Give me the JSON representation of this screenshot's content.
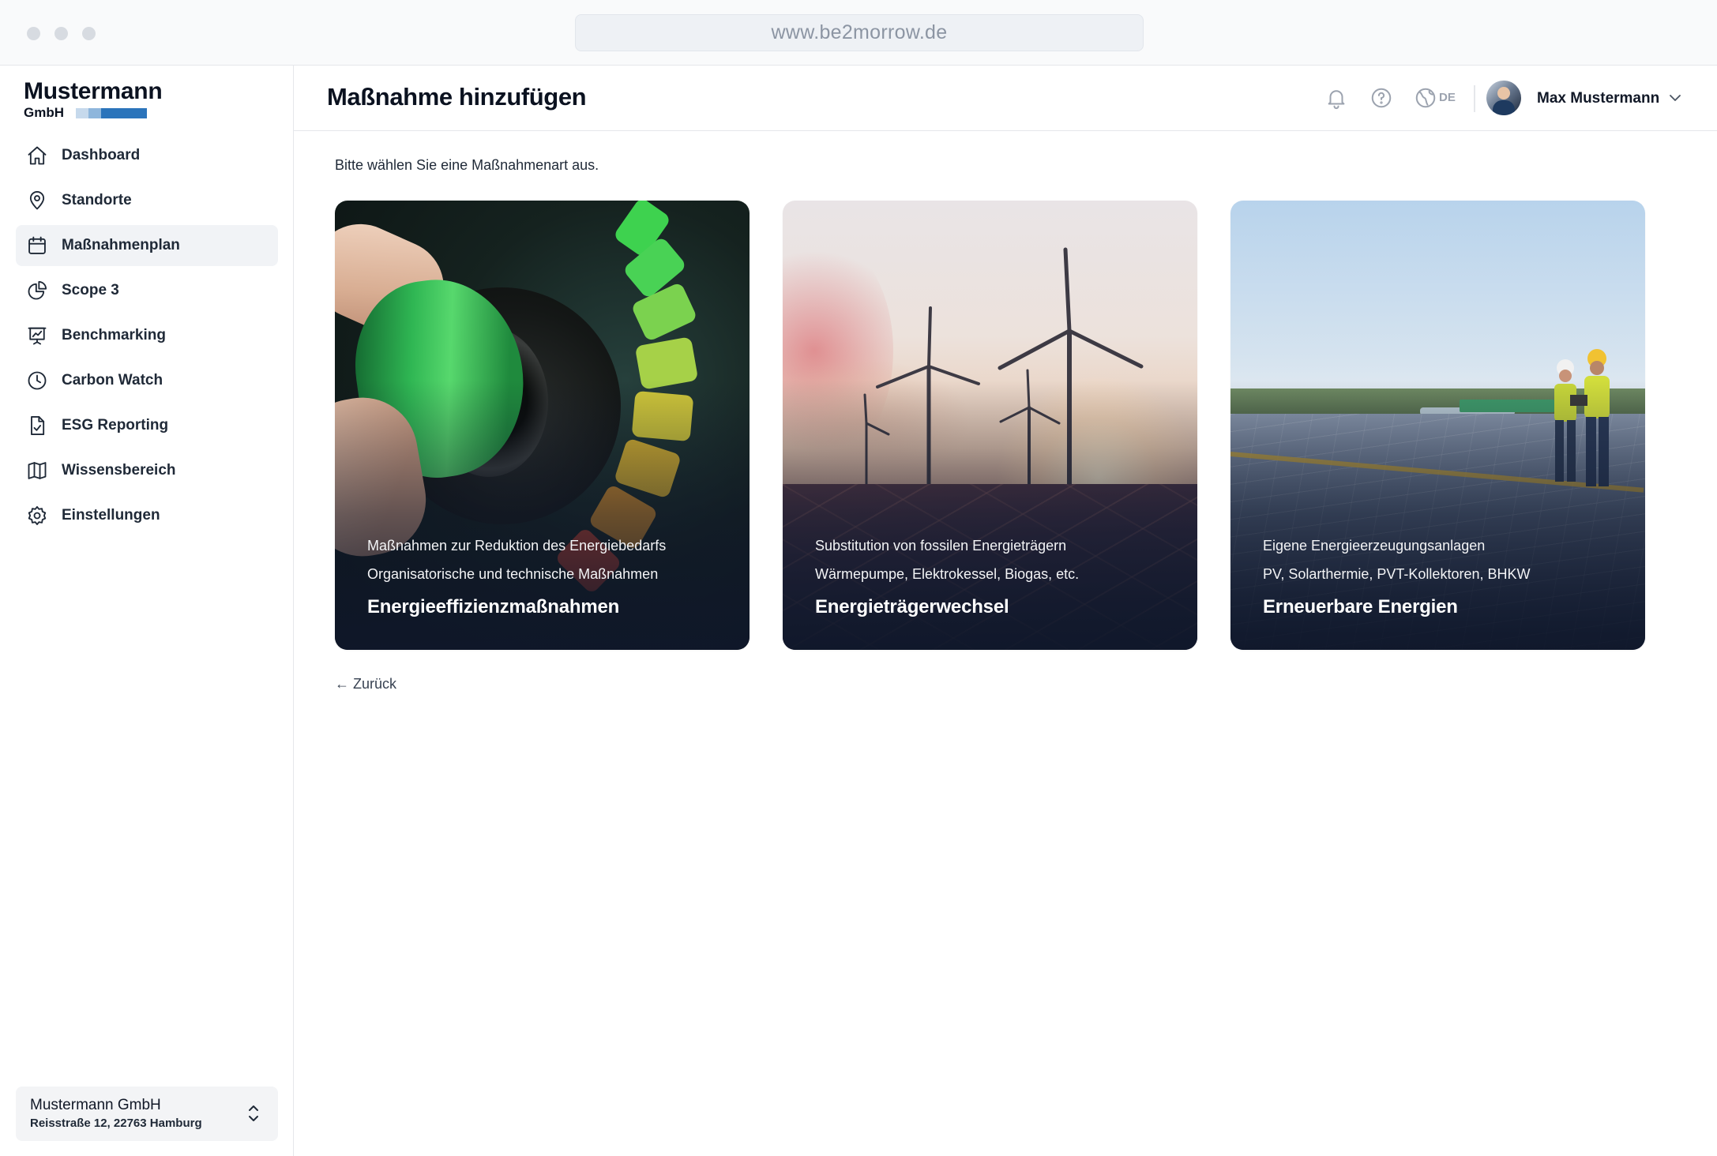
{
  "browser": {
    "url": "www.be2morrow.de"
  },
  "logo": {
    "name": "Mustermann",
    "sub": "GmbH",
    "colors": [
      "#bcd2e8",
      "#8ab3da",
      "#3f86c6",
      "#1d5fa8"
    ]
  },
  "sidebar": {
    "items": [
      {
        "label": "Dashboard",
        "icon": "home-icon",
        "active": false
      },
      {
        "label": "Standorte",
        "icon": "map-pin-icon",
        "active": false
      },
      {
        "label": "Maßnahmenplan",
        "icon": "calendar-icon",
        "active": true
      },
      {
        "label": "Scope 3",
        "icon": "pie-chart-icon",
        "active": false
      },
      {
        "label": "Benchmarking",
        "icon": "presentation-chart-icon",
        "active": false
      },
      {
        "label": "Carbon Watch",
        "icon": "clock-icon",
        "active": false
      },
      {
        "label": "ESG Reporting",
        "icon": "document-check-icon",
        "active": false
      },
      {
        "label": "Wissensbereich",
        "icon": "book-map-icon",
        "active": false
      },
      {
        "label": "Einstellungen",
        "icon": "gear-icon",
        "active": false
      }
    ],
    "company": {
      "name": "Mustermann GmbH",
      "address": "Reisstraße 12, 22763 Hamburg"
    }
  },
  "header": {
    "title": "Maßnahme hinzufügen",
    "language": "DE",
    "user_name": "Max Mustermann"
  },
  "main": {
    "instruction": "Bitte wählen Sie eine Maßnahmenart aus.",
    "cards": [
      {
        "line1": "Maßnahmen zur Reduktion des Energiebedarfs",
        "line2": "Organisatorische und technische Maßnahmen",
        "title": "Energieeffizienzmaßnahmen"
      },
      {
        "line1": "Substitution von fossilen Energieträgern",
        "line2": "Wärmepumpe, Elektrokessel, Biogas, etc.",
        "title": "Energieträgerwechsel"
      },
      {
        "line1": "Eigene Energieerzeugungsanlagen",
        "line2": "PV, Solarthermie, PVT-Kollektoren, BHKW",
        "title": "Erneuerbare Energien"
      }
    ],
    "back_label": "← Zurück"
  },
  "colors": {
    "active_nav_bg": "#f1f3f6",
    "text_primary": "#0b1220",
    "icon_muted": "#9ca3af"
  }
}
